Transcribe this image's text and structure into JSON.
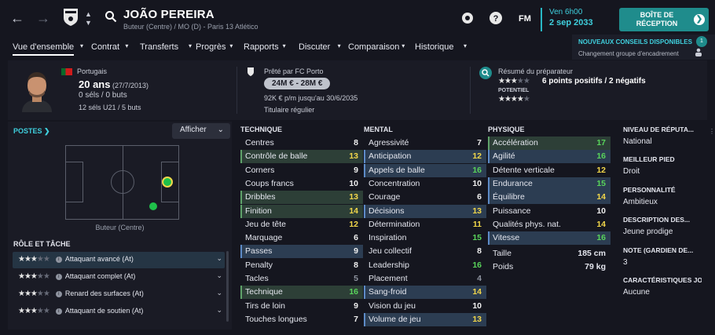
{
  "header": {
    "player_name": "JOÃO PEREIRA",
    "player_sub": "Buteur (Centre) / MO (D) - Paris 13 Atlético",
    "fm_label": "FM",
    "date_time": "Ven 6h00",
    "date": "2 sep 2033",
    "inbox_label": "BOÎTE DE RÉCEPTION",
    "notif_title": "NOUVEAUX CONSEILS DISPONIBLES",
    "notif_text": "Changement groupe d'encadrement",
    "notif_count": "1"
  },
  "menu": [
    {
      "label": "Vue d'ensemble",
      "active": true
    },
    {
      "label": "Contrat"
    },
    {
      "label": "Transferts"
    },
    {
      "label": "Progrès"
    },
    {
      "label": "Rapports"
    },
    {
      "label": "Discuter"
    },
    {
      "label": "Comparaison"
    },
    {
      "label": "Historique"
    }
  ],
  "profile": {
    "nationality": "Portugais",
    "age": "20 ans",
    "dob": "(27/7/2013)",
    "caps": "0 séls / 0 buts",
    "u21": "12 séls U21 / 5 buts",
    "loan": "Prêté par FC Porto",
    "value": "24M € - 28M €",
    "wage": "92K € p/m jusqu'au 30/6/2035",
    "status": "Titulaire régulier",
    "coach_title": "Résumé du préparateur",
    "coach_summary": "6 points positifs / 2 négatifs",
    "potential_label": "POTENTIEL",
    "current_stars": 3.5,
    "potential_stars": 4
  },
  "positions": {
    "title": "POSTES",
    "button": "Afficher",
    "caption": "Buteur (Centre)"
  },
  "roles": {
    "title": "RÔLE ET TÂCHE",
    "items": [
      {
        "label": "Attaquant avancé (At)",
        "stars": 3.5
      },
      {
        "label": "Attaquant complet (At)",
        "stars": 3.5
      },
      {
        "label": "Renard des surfaces (At)",
        "stars": 3.5
      },
      {
        "label": "Attaquant de soutien (At)",
        "stars": 3
      }
    ]
  },
  "technique": {
    "title": "TECHNIQUE",
    "items": [
      {
        "name": "Centres",
        "value": "8"
      },
      {
        "name": "Contrôle de balle",
        "value": "13"
      },
      {
        "name": "Corners",
        "value": "9"
      },
      {
        "name": "Coups francs",
        "value": "10"
      },
      {
        "name": "Dribbles",
        "value": "13"
      },
      {
        "name": "Finition",
        "value": "14"
      },
      {
        "name": "Jeu de tête",
        "value": "12"
      },
      {
        "name": "Marquage",
        "value": "6"
      },
      {
        "name": "Passes",
        "value": "9"
      },
      {
        "name": "Penalty",
        "value": "8"
      },
      {
        "name": "Tacles",
        "value": "5"
      },
      {
        "name": "Technique",
        "value": "16"
      },
      {
        "name": "Tirs de loin",
        "value": "9"
      },
      {
        "name": "Touches longues",
        "value": "7"
      }
    ]
  },
  "mental": {
    "title": "MENTAL",
    "items": [
      {
        "name": "Agressivité",
        "value": "7"
      },
      {
        "name": "Anticipation",
        "value": "12"
      },
      {
        "name": "Appels de balle",
        "value": "16"
      },
      {
        "name": "Concentration",
        "value": "10"
      },
      {
        "name": "Courage",
        "value": "6"
      },
      {
        "name": "Décisions",
        "value": "13"
      },
      {
        "name": "Détermination",
        "value": "11"
      },
      {
        "name": "Inspiration",
        "value": "15"
      },
      {
        "name": "Jeu collectif",
        "value": "8"
      },
      {
        "name": "Leadership",
        "value": "16"
      },
      {
        "name": "Placement",
        "value": "4"
      },
      {
        "name": "Sang-froid",
        "value": "14"
      },
      {
        "name": "Vision du jeu",
        "value": "10"
      },
      {
        "name": "Volume de jeu",
        "value": "13"
      }
    ]
  },
  "physique": {
    "title": "PHYSIQUE",
    "items": [
      {
        "name": "Accélération",
        "value": "17"
      },
      {
        "name": "Agilité",
        "value": "16"
      },
      {
        "name": "Détente verticale",
        "value": "12"
      },
      {
        "name": "Endurance",
        "value": "15"
      },
      {
        "name": "Équilibre",
        "value": "14"
      },
      {
        "name": "Puissance",
        "value": "10"
      },
      {
        "name": "Qualités phys. nat.",
        "value": "14"
      },
      {
        "name": "Vitesse",
        "value": "16"
      }
    ],
    "extras": [
      {
        "name": "Taille",
        "value": "185 cm"
      },
      {
        "name": "Poids",
        "value": "79 kg"
      }
    ]
  },
  "side": [
    {
      "key": "NIVEAU DE RÉPUTA...",
      "value": "National"
    },
    {
      "key": "MEILLEUR PIED",
      "value": "Droit"
    },
    {
      "key": "PERSONNALITÉ",
      "value": "Ambitieux"
    },
    {
      "key": "DESCRIPTION DES...",
      "value": "Jeune prodige"
    },
    {
      "key": "NOTE (GARDIEN DE...",
      "value": "3"
    },
    {
      "key": "CARACTÉRISTIQUES JO...",
      "value": "Aucune"
    }
  ],
  "colors": {
    "accent": "#3fd0de",
    "button": "#1f8c8c",
    "yellow": "#f2d74a",
    "green": "#59d45b"
  }
}
